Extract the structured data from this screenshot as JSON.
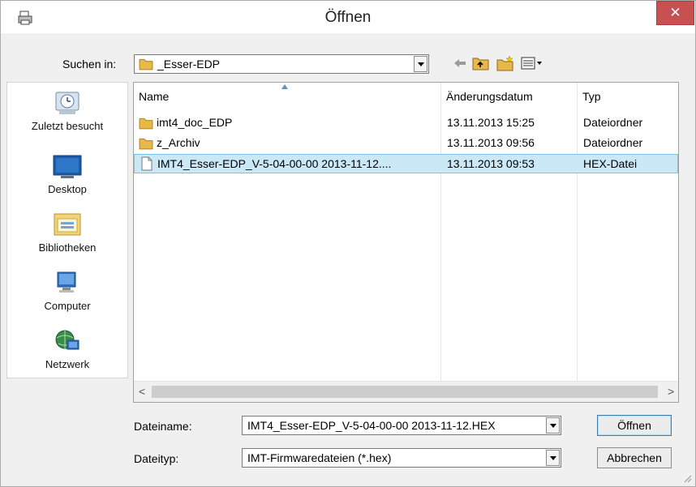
{
  "window": {
    "title": "Öffnen",
    "close_label": "✕"
  },
  "lookin": {
    "label": "Suchen in:",
    "value": "_Esser-EDP"
  },
  "places": [
    {
      "label": "Zuletzt besucht"
    },
    {
      "label": "Desktop"
    },
    {
      "label": "Bibliotheken"
    },
    {
      "label": "Computer"
    },
    {
      "label": "Netzwerk"
    }
  ],
  "columns": {
    "name": "Name",
    "date": "Änderungsdatum",
    "type": "Typ"
  },
  "files": [
    {
      "name": "imt4_doc_EDP",
      "date": "13.11.2013 15:25",
      "type": "Dateiordner",
      "icon": "folder-icon"
    },
    {
      "name": "z_Archiv",
      "date": "13.11.2013 09:56",
      "type": "Dateiordner",
      "icon": "folder-icon"
    },
    {
      "name": "IMT4_Esser-EDP_V-5-04-00-00 2013-11-12....",
      "date": "13.11.2013 09:53",
      "type": "HEX-Datei",
      "icon": "file-icon"
    }
  ],
  "scroll": {
    "left": "<",
    "right": ">"
  },
  "filename": {
    "label": "Dateiname:",
    "value": "IMT4_Esser-EDP_V-5-04-00-00 2013-11-12.HEX"
  },
  "filetype": {
    "label": "Dateityp:",
    "value": "IMT-Firmwaredateien (*.hex)"
  },
  "buttons": {
    "open": "Öffnen",
    "cancel": "Abbrechen"
  },
  "colors": {
    "selection": "#cbe8f6",
    "selection_border": "#7ac3e8",
    "close": "#c75050",
    "folder": "#e8b84a"
  }
}
